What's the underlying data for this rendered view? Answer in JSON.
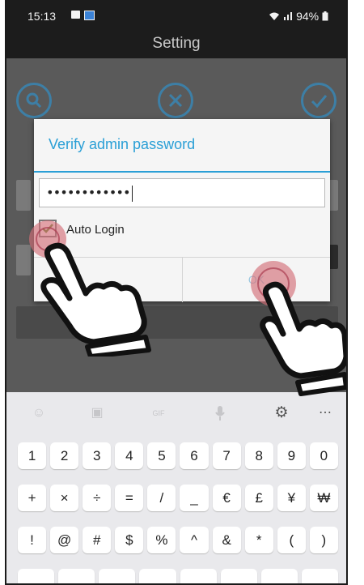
{
  "status_bar": {
    "time": "15:13",
    "battery_text": "94%"
  },
  "header": {
    "title": "Setting"
  },
  "dialog": {
    "title": "Verify admin password",
    "password_value": "••••••••••••",
    "auto_login_label": "Auto Login",
    "auto_login_checked": true,
    "ok_label": "OK"
  },
  "keyboard": {
    "toolbar": [
      "emoji-icon",
      "sticker-icon",
      "gif-icon",
      "microphone-icon",
      "settings-icon",
      "more-icon"
    ],
    "rows": [
      [
        "1",
        "2",
        "3",
        "4",
        "5",
        "6",
        "7",
        "8",
        "9",
        "0"
      ],
      [
        "+",
        "×",
        "÷",
        "=",
        "/",
        "_",
        "€",
        "£",
        "¥",
        "₩"
      ],
      [
        "!",
        "@",
        "#",
        "$",
        "%",
        "^",
        "&",
        "*",
        "(",
        ")"
      ]
    ]
  },
  "colors": {
    "accent": "#2a9fd6",
    "tap_marker": "#d26e78"
  }
}
